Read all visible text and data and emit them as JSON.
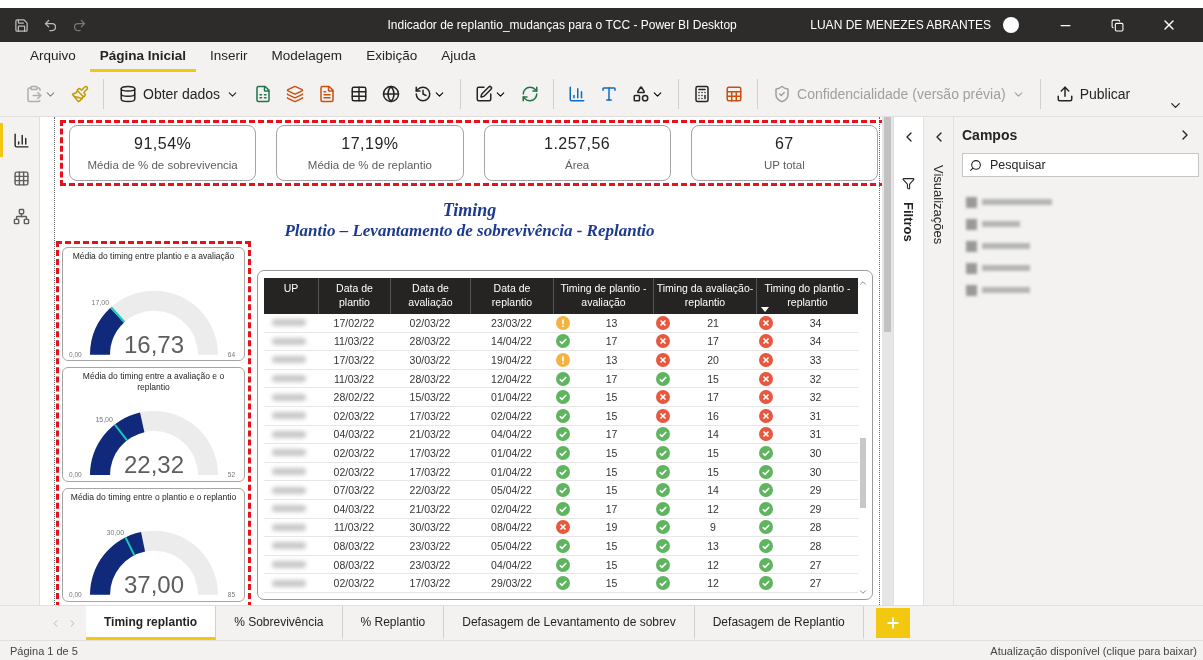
{
  "title_bar": {
    "title": "Indicador de replantio_mudanças para o TCC - Power BI Desktop",
    "user": "LUAN DE MENEZES ABRANTES"
  },
  "menu": [
    {
      "label": "Arquivo",
      "selected": false
    },
    {
      "label": "Página Inicial",
      "selected": true
    },
    {
      "label": "Inserir",
      "selected": false
    },
    {
      "label": "Modelagem",
      "selected": false
    },
    {
      "label": "Exibição",
      "selected": false
    },
    {
      "label": "Ajuda",
      "selected": false
    }
  ],
  "toolbar": [
    {
      "kind": "icon",
      "disabled": true,
      "caret": true
    },
    {
      "kind": "icon",
      "disabled": false,
      "caret": false
    },
    {
      "kind": "separator"
    },
    {
      "kind": "button",
      "label": "Obter dados",
      "disabled": false,
      "caret": true
    },
    {
      "kind": "icon",
      "disabled": false,
      "caret": false
    },
    {
      "kind": "icon",
      "disabled": false,
      "caret": false
    },
    {
      "kind": "icon",
      "disabled": false,
      "caret": false
    },
    {
      "kind": "icon",
      "disabled": false,
      "caret": false
    },
    {
      "kind": "icon",
      "disabled": false,
      "caret": false
    },
    {
      "kind": "icon",
      "disabled": false,
      "caret": true
    },
    {
      "kind": "separator"
    },
    {
      "kind": "icon",
      "disabled": false,
      "caret": true
    },
    {
      "kind": "icon",
      "disabled": false,
      "caret": false
    },
    {
      "kind": "separator"
    },
    {
      "kind": "icon",
      "disabled": false,
      "caret": false
    },
    {
      "kind": "icon",
      "disabled": false,
      "caret": false
    },
    {
      "kind": "icon",
      "disabled": false,
      "caret": true
    },
    {
      "kind": "separator"
    },
    {
      "kind": "icon",
      "disabled": false,
      "caret": false
    },
    {
      "kind": "icon",
      "disabled": false,
      "caret": false
    },
    {
      "kind": "separator"
    },
    {
      "kind": "button",
      "label": "Confidencialidade (versão prévia)",
      "disabled": true,
      "caret": true
    },
    {
      "kind": "separator"
    },
    {
      "kind": "button",
      "label": "Publicar",
      "disabled": false,
      "caret": false
    }
  ],
  "view_rail": [
    {
      "selected": true
    },
    {
      "selected": false
    },
    {
      "selected": false
    }
  ],
  "kpis": [
    {
      "value": "91,54%",
      "label": "Média de % de sobrevivencia"
    },
    {
      "value": "17,19%",
      "label": "Média de % de replantio"
    },
    {
      "value": "1.257,56",
      "label": "Área"
    },
    {
      "value": "67",
      "label": "UP total"
    }
  ],
  "report_title": {
    "title": "Timing",
    "subtitle": "Plantio – Levantamento de sobrevivência - Replantio"
  },
  "gauges": [
    {
      "title": "Média do timing entre plantio e a avaliação",
      "value": "16,73",
      "min": "0,00",
      "max": "64",
      "level": 0.26,
      "target": {
        "label": "17,00",
        "level": 0.266
      }
    },
    {
      "title": "Média do timing entre a avaliação e o replantio",
      "value": "22,32",
      "min": "0,00",
      "max": "52",
      "level": 0.43,
      "target": {
        "label": "15,00",
        "level": 0.29
      }
    },
    {
      "title": "Média do timing entre o plantio e o replantio",
      "value": "37,00",
      "min": "0,00",
      "max": "85",
      "level": 0.435,
      "target": {
        "label": "30,00",
        "level": 0.353
      }
    }
  ],
  "table": {
    "columns": [
      {
        "label": "UP",
        "sorted": false
      },
      {
        "label": "Data de plantio",
        "sorted": false
      },
      {
        "label": "Data de avaliação",
        "sorted": false
      },
      {
        "label": "Data de replantio",
        "sorted": false
      },
      {
        "label": "Timing de plantio - avaliação",
        "sorted": false
      },
      {
        "label": "Timing da avaliação-replantio",
        "sorted": false
      },
      {
        "label": "Timing do plantio - replantio",
        "sorted": true
      }
    ],
    "rows": [
      {
        "dates": [
          "17/02/22",
          "02/03/22",
          "23/03/22"
        ],
        "timings": [
          {
            "kind": "warn",
            "value": "13"
          },
          {
            "kind": "bad",
            "value": "21"
          },
          {
            "kind": "bad",
            "value": "34"
          }
        ]
      },
      {
        "dates": [
          "11/03/22",
          "28/03/22",
          "14/04/22"
        ],
        "timings": [
          {
            "kind": "ok",
            "value": "17"
          },
          {
            "kind": "bad",
            "value": "17"
          },
          {
            "kind": "bad",
            "value": "34"
          }
        ]
      },
      {
        "dates": [
          "17/03/22",
          "30/03/22",
          "19/04/22"
        ],
        "timings": [
          {
            "kind": "warn",
            "value": "13"
          },
          {
            "kind": "bad",
            "value": "20"
          },
          {
            "kind": "bad",
            "value": "33"
          }
        ]
      },
      {
        "dates": [
          "11/03/22",
          "28/03/22",
          "12/04/22"
        ],
        "timings": [
          {
            "kind": "ok",
            "value": "17"
          },
          {
            "kind": "ok",
            "value": "15"
          },
          {
            "kind": "bad",
            "value": "32"
          }
        ]
      },
      {
        "dates": [
          "28/02/22",
          "15/03/22",
          "01/04/22"
        ],
        "timings": [
          {
            "kind": "ok",
            "value": "15"
          },
          {
            "kind": "bad",
            "value": "17"
          },
          {
            "kind": "bad",
            "value": "32"
          }
        ]
      },
      {
        "dates": [
          "02/03/22",
          "17/03/22",
          "02/04/22"
        ],
        "timings": [
          {
            "kind": "ok",
            "value": "15"
          },
          {
            "kind": "bad",
            "value": "16"
          },
          {
            "kind": "bad",
            "value": "31"
          }
        ]
      },
      {
        "dates": [
          "04/03/22",
          "21/03/22",
          "04/04/22"
        ],
        "timings": [
          {
            "kind": "ok",
            "value": "17"
          },
          {
            "kind": "ok",
            "value": "14"
          },
          {
            "kind": "bad",
            "value": "31"
          }
        ]
      },
      {
        "dates": [
          "02/03/22",
          "17/03/22",
          "01/04/22"
        ],
        "timings": [
          {
            "kind": "ok",
            "value": "15"
          },
          {
            "kind": "ok",
            "value": "15"
          },
          {
            "kind": "ok",
            "value": "30"
          }
        ]
      },
      {
        "dates": [
          "02/03/22",
          "17/03/22",
          "01/04/22"
        ],
        "timings": [
          {
            "kind": "ok",
            "value": "15"
          },
          {
            "kind": "ok",
            "value": "15"
          },
          {
            "kind": "ok",
            "value": "30"
          }
        ]
      },
      {
        "dates": [
          "07/03/22",
          "22/03/22",
          "05/04/22"
        ],
        "timings": [
          {
            "kind": "ok",
            "value": "15"
          },
          {
            "kind": "ok",
            "value": "14"
          },
          {
            "kind": "ok",
            "value": "29"
          }
        ]
      },
      {
        "dates": [
          "04/03/22",
          "21/03/22",
          "02/04/22"
        ],
        "timings": [
          {
            "kind": "ok",
            "value": "17"
          },
          {
            "kind": "ok",
            "value": "12"
          },
          {
            "kind": "ok",
            "value": "29"
          }
        ]
      },
      {
        "dates": [
          "11/03/22",
          "30/03/22",
          "08/04/22"
        ],
        "timings": [
          {
            "kind": "bad",
            "value": "19"
          },
          {
            "kind": "ok",
            "value": "9"
          },
          {
            "kind": "ok",
            "value": "28"
          }
        ]
      },
      {
        "dates": [
          "08/03/22",
          "23/03/22",
          "05/04/22"
        ],
        "timings": [
          {
            "kind": "ok",
            "value": "15"
          },
          {
            "kind": "ok",
            "value": "13"
          },
          {
            "kind": "ok",
            "value": "28"
          }
        ]
      },
      {
        "dates": [
          "08/03/22",
          "23/03/22",
          "04/04/22"
        ],
        "timings": [
          {
            "kind": "ok",
            "value": "15"
          },
          {
            "kind": "ok",
            "value": "12"
          },
          {
            "kind": "ok",
            "value": "27"
          }
        ]
      },
      {
        "dates": [
          "02/03/22",
          "17/03/22",
          "29/03/22"
        ],
        "timings": [
          {
            "kind": "ok",
            "value": "15"
          },
          {
            "kind": "ok",
            "value": "12"
          },
          {
            "kind": "ok",
            "value": "27"
          }
        ]
      }
    ]
  },
  "panes": {
    "filters": {
      "label": "Filtros"
    },
    "visualizations": {
      "label": "Visualizações"
    },
    "fields": {
      "title": "Campos",
      "search": {
        "placeholder": "Pesquisar"
      }
    }
  },
  "page_tabs": [
    {
      "label": "Timing replantio",
      "selected": true
    },
    {
      "label": "% Sobrevivência",
      "selected": false
    },
    {
      "label": "% Replantio",
      "selected": false
    },
    {
      "label": "Defasagem de Levantamento de sobrev",
      "selected": false
    },
    {
      "label": "Defasagem de Replantio",
      "selected": false
    }
  ],
  "status_bar": {
    "page": "Página 1 de 5",
    "update": "Atualização disponível (clique para baixar)"
  }
}
